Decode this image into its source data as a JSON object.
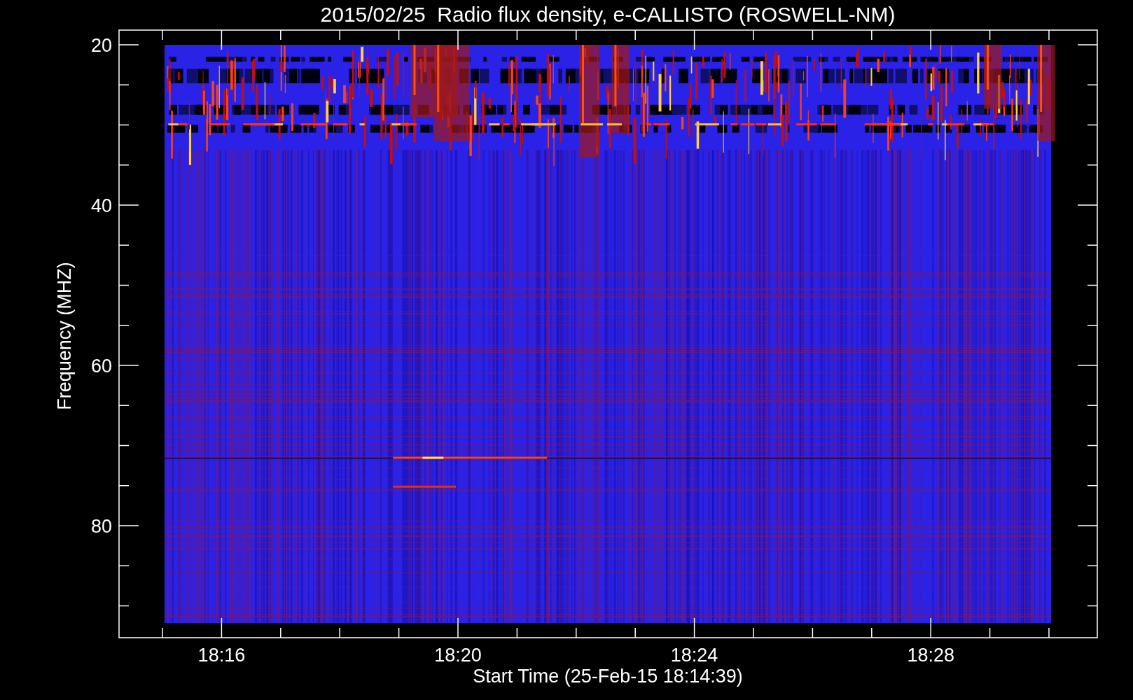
{
  "plot": {
    "title": "2015/02/25  Radio flux density, e-CALLISTO (ROSWELL-NM)",
    "y_label": "Frequency (MHZ)",
    "x_label": "Start Time (25-Feb-15 18:14:39)",
    "y_ticks": [
      "20",
      "40",
      "60",
      "80"
    ],
    "x_ticks": [
      "18:16",
      "18:20",
      "18:24",
      "18:28"
    ]
  }
}
